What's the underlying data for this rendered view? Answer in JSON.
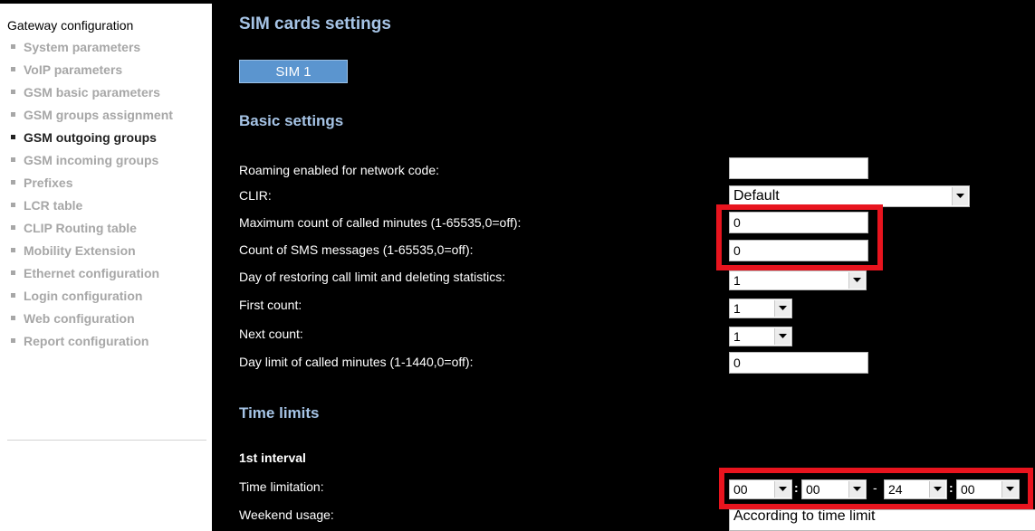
{
  "sidebar": {
    "title": "Gateway configuration",
    "items": [
      {
        "label": "System parameters",
        "active": false
      },
      {
        "label": "VoIP parameters",
        "active": false
      },
      {
        "label": "GSM basic parameters",
        "active": false
      },
      {
        "label": "GSM groups assignment",
        "active": false
      },
      {
        "label": "GSM outgoing groups",
        "active": true
      },
      {
        "label": "GSM incoming groups",
        "active": false
      },
      {
        "label": "Prefixes",
        "active": false
      },
      {
        "label": "LCR table",
        "active": false
      },
      {
        "label": "CLIP Routing table",
        "active": false
      },
      {
        "label": "Mobility Extension",
        "active": false
      },
      {
        "label": "Ethernet configuration",
        "active": false
      },
      {
        "label": "Login configuration",
        "active": false
      },
      {
        "label": "Web configuration",
        "active": false
      },
      {
        "label": "Report configuration",
        "active": false
      }
    ]
  },
  "main": {
    "title": "SIM cards settings",
    "sim_tab": "SIM 1",
    "basic_heading": "Basic settings",
    "fields": {
      "roaming": {
        "label": "Roaming enabled for network code:",
        "value": ""
      },
      "clir": {
        "label": "CLIR:",
        "value": "Default"
      },
      "max_minutes": {
        "label": "Maximum count of called minutes (1-65535,0=off):",
        "value": "0"
      },
      "sms_count": {
        "label": "Count of SMS messages (1-65535,0=off):",
        "value": "0"
      },
      "restore_day": {
        "label": "Day of restoring call limit and deleting statistics:",
        "value": "1"
      },
      "first_count": {
        "label": "First count:",
        "value": "1"
      },
      "next_count": {
        "label": "Next count:",
        "value": "1"
      },
      "day_limit": {
        "label": "Day limit of called minutes (1-1440,0=off):",
        "value": "0"
      }
    },
    "time_heading": "Time limits",
    "interval_label": "1st interval",
    "time_limitation": {
      "label": "Time limitation:",
      "start_hour": "00",
      "start_min": "00",
      "end_hour": "24",
      "end_min": "00",
      "colon": ":",
      "dash": "-"
    },
    "weekend": {
      "label": "Weekend usage:",
      "value": "According to time limit"
    }
  },
  "colors": {
    "highlight": "#e8141e",
    "heading": "#a6c4e6",
    "tab": "#5b95cf"
  }
}
